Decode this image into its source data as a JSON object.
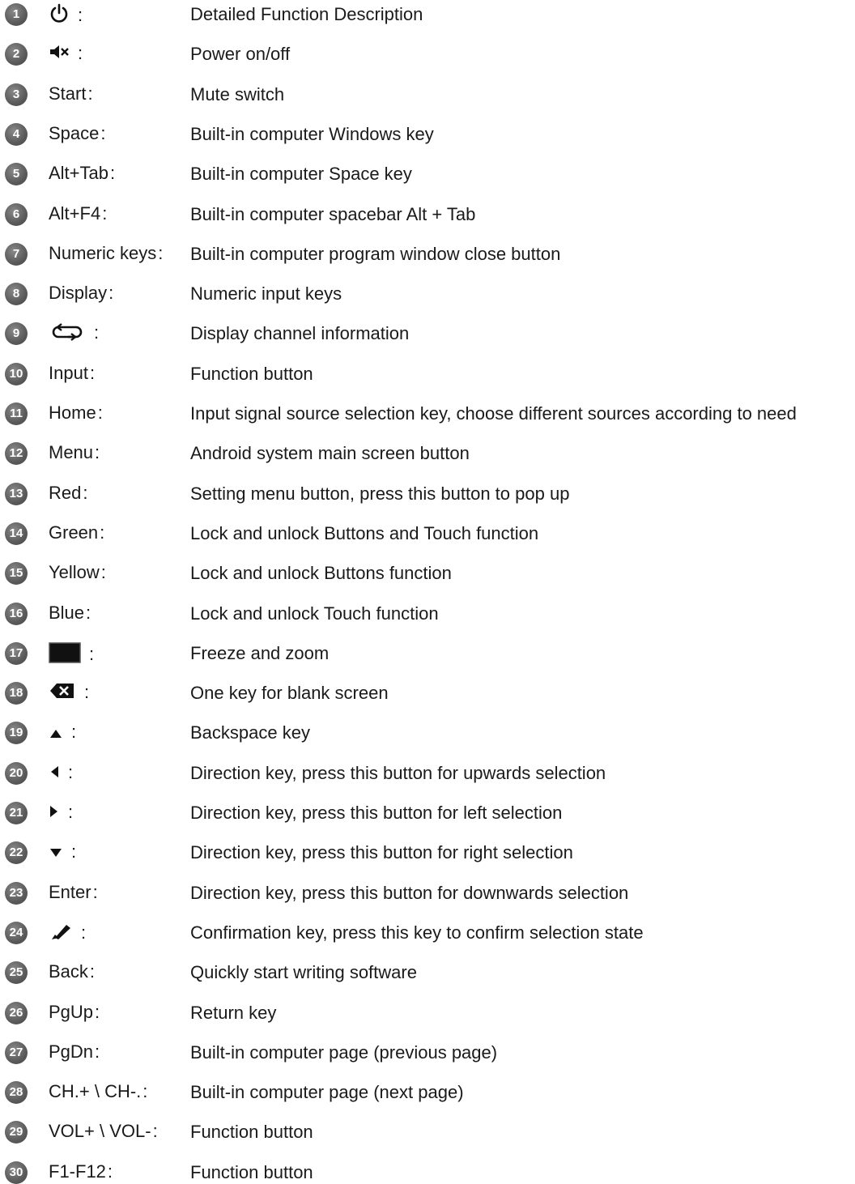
{
  "rows": [
    {
      "num": "1",
      "key": "",
      "icon": "power-icon",
      "sep": ":",
      "desc": "Detailed Function Description"
    },
    {
      "num": "2",
      "key": "",
      "icon": "mute-icon",
      "sep": ":",
      "desc": "Power on/off"
    },
    {
      "num": "3",
      "key": "Start",
      "icon": "",
      "sep": ":",
      "desc": "Mute switch"
    },
    {
      "num": "4",
      "key": "Space",
      "icon": "",
      "sep": ":",
      "desc": "Built-in computer Windows key"
    },
    {
      "num": "5",
      "key": "Alt+Tab",
      "icon": "",
      "sep": ":",
      "desc": "Built-in computer Space key"
    },
    {
      "num": "6",
      "key": "Alt+F4",
      "icon": "",
      "sep": ":",
      "desc": "Built-in computer spacebar Alt + Tab"
    },
    {
      "num": "7",
      "key": "Numeric keys",
      "icon": "",
      "sep": ":",
      "desc": "Built-in computer program window close button"
    },
    {
      "num": "8",
      "key": "Display",
      "icon": "",
      "sep": ":",
      "desc": "Numeric input keys"
    },
    {
      "num": "9",
      "key": "",
      "icon": "swap-loop-icon",
      "sep": ":",
      "desc": "Display channel information"
    },
    {
      "num": "10",
      "key": "Input",
      "icon": "",
      "sep": ":",
      "desc": "Function button"
    },
    {
      "num": "11",
      "key": "Home",
      "icon": "",
      "sep": ":",
      "desc": "Input signal source selection key, choose different sources according to need"
    },
    {
      "num": "12",
      "key": "Menu",
      "icon": "",
      "sep": ":",
      "desc": "Android system main screen button"
    },
    {
      "num": "13",
      "key": "Red",
      "icon": "",
      "sep": ":",
      "desc": "Setting menu button, press this button to pop up"
    },
    {
      "num": "14",
      "key": "Green",
      "icon": "",
      "sep": ":",
      "desc": "Lock and unlock Buttons and Touch function"
    },
    {
      "num": "15",
      "key": "Yellow",
      "icon": "",
      "sep": ":",
      "desc": "Lock and unlock Buttons function"
    },
    {
      "num": "16",
      "key": "Blue",
      "icon": "",
      "sep": ":",
      "desc": "Lock and unlock Touch function"
    },
    {
      "num": "17",
      "key": "",
      "icon": "blank-screen-icon",
      "sep": ":",
      "desc": "Freeze and zoom"
    },
    {
      "num": "18",
      "key": "",
      "icon": "backspace-icon",
      "sep": ":",
      "desc": "One key for blank screen"
    },
    {
      "num": "19",
      "key": "",
      "icon": "arrow-up-icon",
      "sep": ":",
      "desc": "Backspace key"
    },
    {
      "num": "20",
      "key": "",
      "icon": "arrow-left-icon",
      "sep": ":",
      "desc": "Direction key, press this button for upwards selection"
    },
    {
      "num": "21",
      "key": "",
      "icon": "arrow-right-icon",
      "sep": ":",
      "desc": "Direction key, press this button for left selection"
    },
    {
      "num": "22",
      "key": "",
      "icon": "arrow-down-icon",
      "sep": ":",
      "desc": "Direction key, press this button for right selection"
    },
    {
      "num": "23",
      "key": "Enter",
      "icon": "",
      "sep": ":",
      "desc": "Direction key, press this button for downwards selection"
    },
    {
      "num": "24",
      "key": "",
      "icon": "pen-icon",
      "sep": ":",
      "desc": "Confirmation key, press this key to confirm selection state"
    },
    {
      "num": "25",
      "key": "Back",
      "icon": "",
      "sep": ":",
      "desc": "Quickly start writing software"
    },
    {
      "num": "26",
      "key": "PgUp",
      "icon": "",
      "sep": ":",
      "desc": "Return key"
    },
    {
      "num": "27",
      "key": "PgDn",
      "icon": "",
      "sep": ":",
      "desc": "Built-in computer page (previous page)"
    },
    {
      "num": "28",
      "key": "CH.+ \\ CH-.",
      "icon": "",
      "sep": ":",
      "desc": "Built-in computer page (next page)"
    },
    {
      "num": "29",
      "key": "VOL+ \\ VOL-",
      "icon": "",
      "sep": ":",
      "desc": "Function button"
    },
    {
      "num": "30",
      "key": "F1-F12",
      "icon": "",
      "sep": ":",
      "desc": ""
    }
  ],
  "last_desc": "Function button"
}
